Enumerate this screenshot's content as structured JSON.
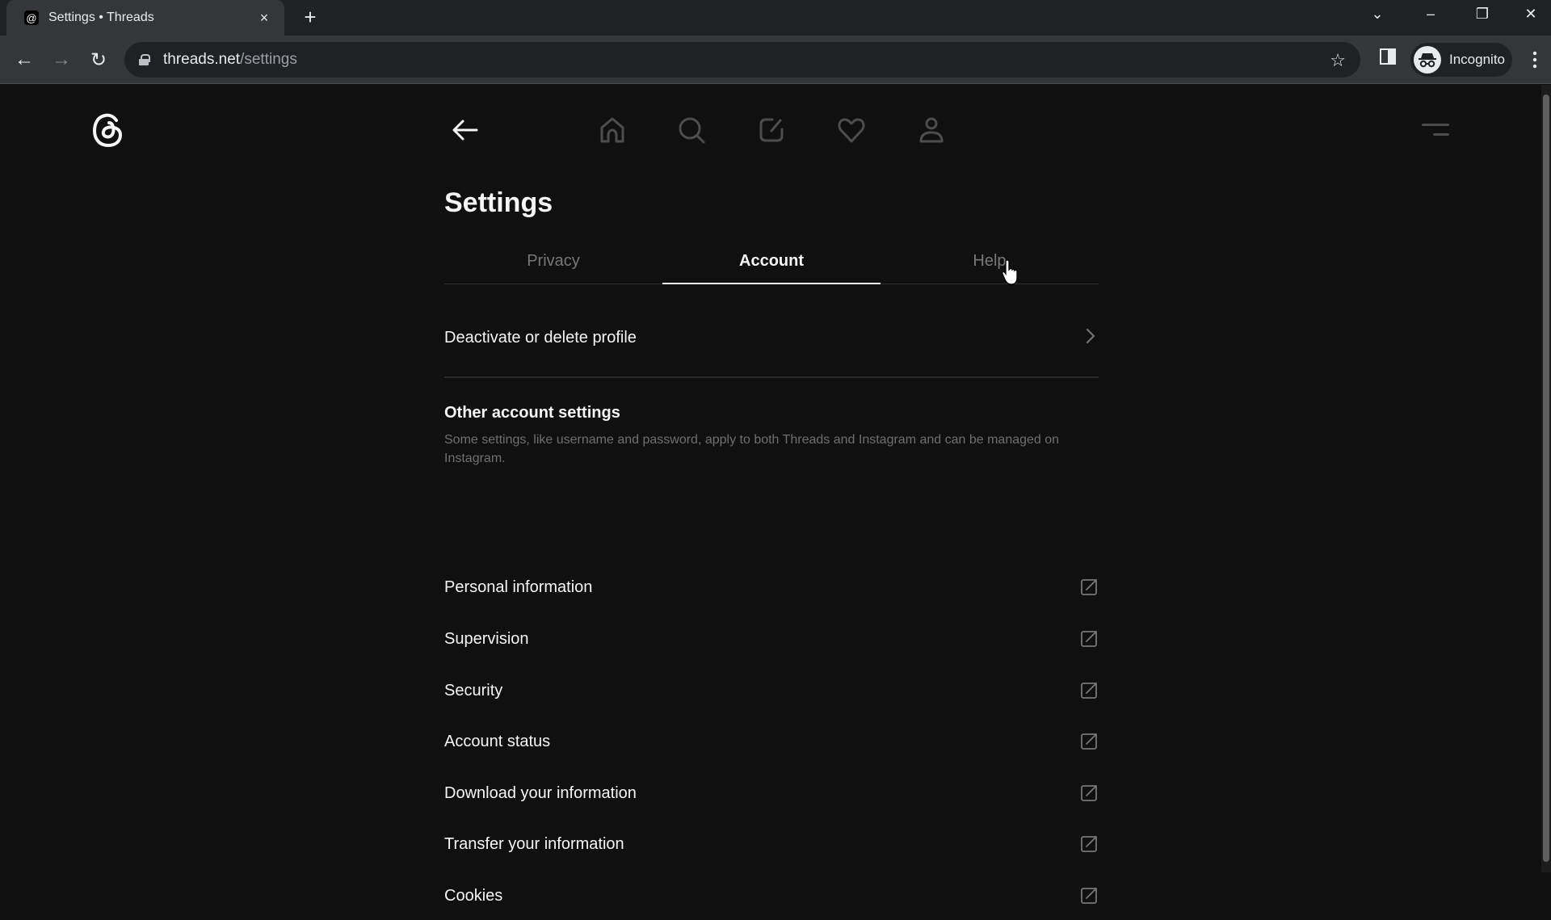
{
  "browser": {
    "tab_title": "Settings • Threads",
    "tab_close_icon": "×",
    "new_tab_icon": "+",
    "url_host": "threads.net",
    "url_path": "/settings",
    "profile_label": "Incognito",
    "window_controls": {
      "tab_search": "⌄",
      "minimize": "–",
      "restore": "❐",
      "close": "✕"
    },
    "nav": {
      "back": "←",
      "forward": "→",
      "reload": "↻"
    },
    "star_icon": "☆",
    "menu_icon": "⋮"
  },
  "app": {
    "page_title": "Settings",
    "tabs": [
      {
        "label": "Privacy",
        "active": false
      },
      {
        "label": "Account",
        "active": true
      },
      {
        "label": "Help",
        "active": false
      }
    ],
    "top_nav": [
      "home",
      "search",
      "compose",
      "activity",
      "profile"
    ],
    "deactivate_label": "Deactivate or delete profile",
    "section": {
      "title": "Other account settings",
      "description": "Some settings, like username and password, apply to both Threads and Instagram and can be managed on Instagram."
    },
    "external_items": [
      {
        "label": "Personal information"
      },
      {
        "label": "Supervision"
      },
      {
        "label": "Security"
      },
      {
        "label": "Account status"
      },
      {
        "label": "Download your information"
      },
      {
        "label": "Transfer your information"
      },
      {
        "label": "Cookies"
      }
    ]
  },
  "colors": {
    "background": "#101010",
    "text_primary": "#f3f5f7",
    "text_secondary": "#777777",
    "icon_muted": "#4d4d4d"
  }
}
